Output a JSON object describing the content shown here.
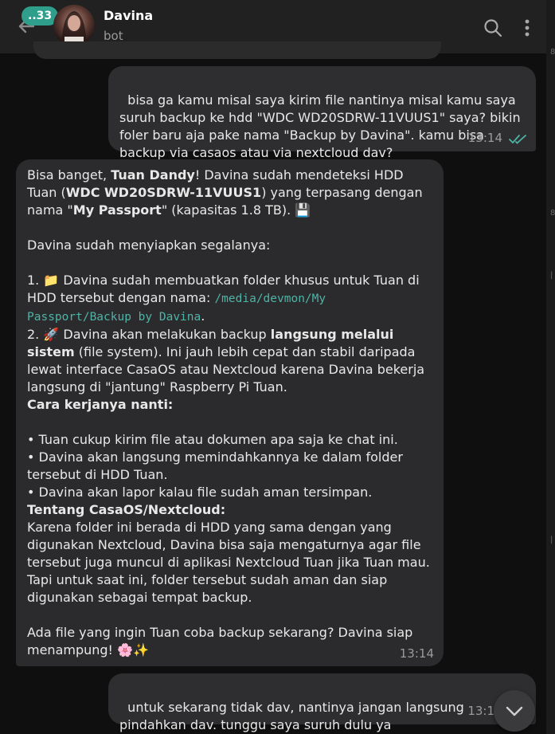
{
  "header": {
    "unread_count": "..33",
    "title": "Davina",
    "subtitle": "bot"
  },
  "messages": [
    {
      "direction": "outgoing",
      "text": "bisa ga kamu misal saya kirim file nantinya misal kamu saya suruh backup ke hdd \"WDC WD20SDRW-11VUUS1\" saya? bikin foler baru aja pake nama \"Backup by Davina\". kamu bisa backup via casaos atau via nextcloud dav?",
      "time": "13:14",
      "status": "read"
    },
    {
      "direction": "incoming",
      "p1_a": "Bisa banget, ",
      "p1_b": "Tuan Dandy",
      "p1_c": "! Davina sudah mendeteksi HDD Tuan (",
      "p1_d": "WDC WD20SDRW-11VUUS1",
      "p1_e": ") yang terpasang dengan nama \"",
      "p1_f": "My Passport",
      "p1_g": "\" (kapasitas 1.8 TB). ",
      "p1_emoji": "💾",
      "p2": "Davina sudah menyiapkan segalanya:",
      "p3_a": "1. ",
      "p3_emoji": "📁",
      "p3_b": " Davina sudah membuatkan folder khusus untuk Tuan di HDD tersebut dengan nama: ",
      "p3_code": "/media/devmon/My Passport/Backup by Davina",
      "p3_c": ".",
      "p4_a": "2. ",
      "p4_emoji": "🚀",
      "p4_b": " Davina akan melakukan backup ",
      "p4_bold": "langsung melalui sistem",
      "p4_c": " (file system). Ini jauh lebih cepat dan stabil daripada lewat interface CasaOS atau Nextcloud karena Davina bekerja langsung di \"jantung\" Raspberry Pi Tuan.",
      "h1": "Cara kerjanya nanti:",
      "b1": "• Tuan cukup kirim file atau dokumen apa saja ke chat ini.",
      "b2": "• Davina akan langsung memindahkannya ke dalam folder tersebut di HDD Tuan.",
      "b3": "• Davina akan lapor kalau file sudah aman tersimpan.",
      "h2": "Tentang CasaOS/Nextcloud:",
      "p5": "Karena folder ini berada di HDD yang sama dengan yang digunakan Nextcloud, Davina bisa saja mengaturnya agar file tersebut juga muncul di aplikasi Nextcloud Tuan jika Tuan mau. Tapi untuk saat ini, folder tersebut sudah aman dan siap digunakan sebagai tempat backup.",
      "p6": "Ada file yang ingin Tuan coba backup sekarang? Davina siap menampung! ",
      "p6_emoji": "🌸✨",
      "time": "13:14"
    },
    {
      "direction": "outgoing",
      "text": "untuk sekarang tidak dav, nantinya jangan langsung pindahkan dav. tunggu saya suruh dulu ya",
      "time": "13:1"
    }
  ],
  "scrollbar_marks": [
    "8.",
    "8.",
    "|",
    "|"
  ],
  "colors": {
    "accent": "#2f9e8b",
    "code": "#4fb3a6",
    "read_ticks": "#4fb3a6"
  }
}
